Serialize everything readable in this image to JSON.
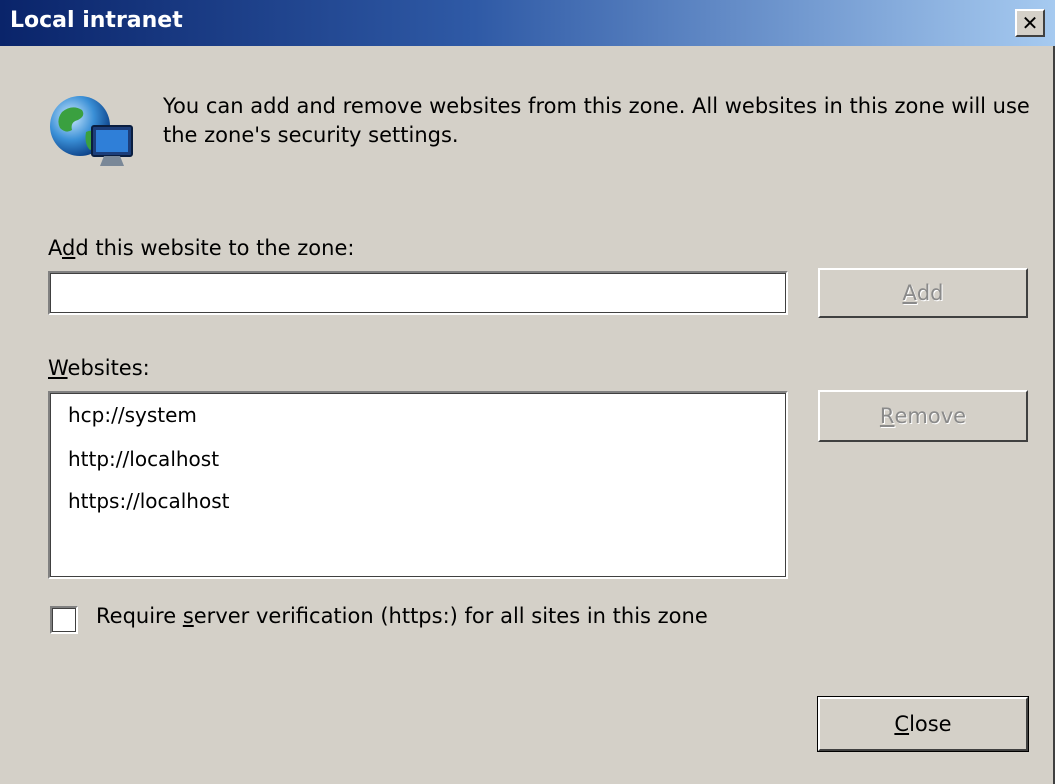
{
  "window": {
    "title": "Local intranet",
    "close_glyph": "✕"
  },
  "info": {
    "icon": "globe-computer-icon",
    "text": "You can add and remove websites from this zone. All websites in this zone will use the zone's security settings."
  },
  "add_section": {
    "label_prefix": "A",
    "label_mnemonic": "d",
    "label_rest": "d this website to the zone:",
    "input_value": "",
    "add_button": {
      "mnemonic": "A",
      "rest": "dd",
      "enabled": false
    }
  },
  "websites_section": {
    "label_mnemonic": "W",
    "label_rest": "ebsites:",
    "items": [
      "hcp://system",
      "http://localhost",
      "https://localhost"
    ],
    "remove_button": {
      "mnemonic": "R",
      "rest": "emove",
      "enabled": false
    }
  },
  "verification": {
    "checked": false,
    "label_prefix": "Require ",
    "label_mnemonic": "s",
    "label_rest": "erver verification (https:) for all sites in this zone"
  },
  "footer": {
    "close_button": {
      "mnemonic": "C",
      "rest": "lose"
    }
  }
}
